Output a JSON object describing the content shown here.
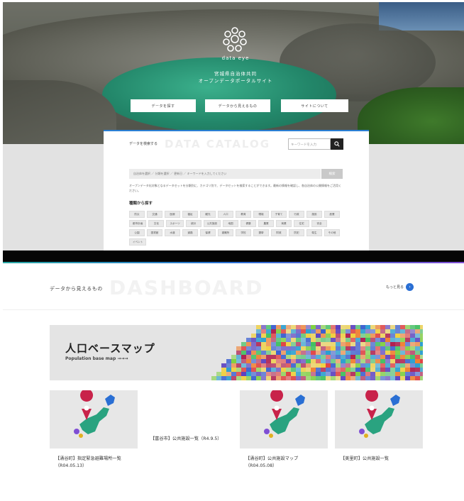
{
  "hero": {
    "logo_text": "data eye",
    "title_line1": "宮城県自治体共同",
    "title_line2": "オープンデータポータルサイト",
    "buttons": [
      "データを探す",
      "データから見えるもの",
      "サイトについて"
    ]
  },
  "catalog": {
    "bg_word": "DATA CATALOG",
    "search_label": "データを検索する",
    "search_placeholder": "キーワードを入力",
    "filter_text": "自治体を選択 ／ 分類を選択 ／ 更新日 ／ キーワードを入力してください",
    "filter_button": "検索",
    "description": "オープンデータ化対象となるデータセットを分類別に、カテゴリ別で、データセットを検索することができます。最新の情報を確認し、各自治体の公開情報をご活用ください。",
    "category_title": "種類から探す",
    "tags": [
      "防災",
      "交通",
      "医療",
      "福祉",
      "観光",
      "人口",
      "教育",
      "環境",
      "子育て",
      "行政",
      "施設",
      "産業",
      "都市計画",
      "文化",
      "スポーツ",
      "統計",
      "公共施設",
      "地図",
      "健康",
      "農業",
      "商業",
      "住宅",
      "安全",
      "公園",
      "図書館",
      "水道",
      "道路",
      "保健",
      "避難所",
      "学校",
      "選挙",
      "財政",
      "防犯",
      "衛生",
      "その他",
      "イベント"
    ]
  },
  "dashboard": {
    "bg_word": "DASHBOARD",
    "title": "データから見えるもの",
    "more_label": "もっと見る",
    "banner_title": "人口ベースマップ",
    "banner_subtitle": "Population base map →→→",
    "cards": [
      {
        "caption": "【涌谷町】指定緊急避難場所一覧（R04.05.13）"
      },
      {
        "caption": "【富谷市】公共施設一覧（R4.9.5）"
      },
      {
        "caption": "【涌谷町】公共施設マップ（R04.05.08）"
      },
      {
        "caption": "【美里町】公共施設一覧"
      }
    ]
  }
}
